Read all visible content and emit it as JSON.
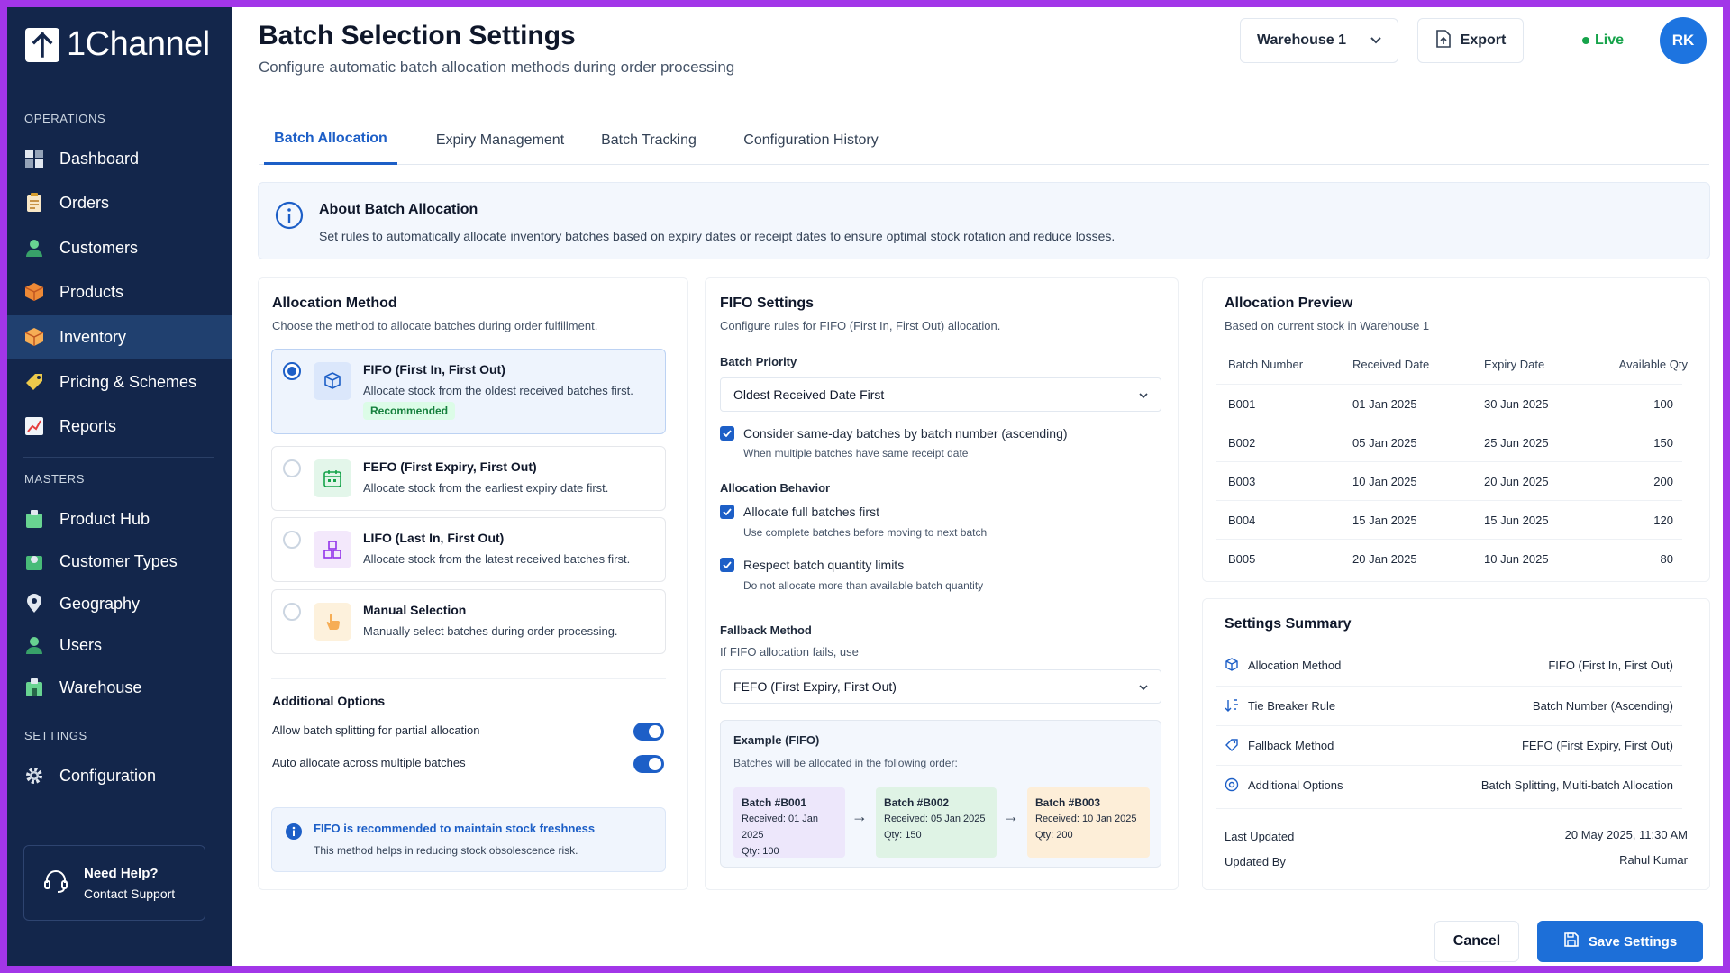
{
  "app": {
    "name": "1Channel"
  },
  "sidebar": {
    "sections": [
      "OPERATIONS",
      "MASTERS",
      "SETTINGS"
    ],
    "operations": [
      {
        "label": "Dashboard",
        "icon": "dashboard-icon"
      },
      {
        "label": "Orders",
        "icon": "clipboard-icon"
      },
      {
        "label": "Customers",
        "icon": "customers-icon"
      },
      {
        "label": "Products",
        "icon": "box-icon"
      },
      {
        "label": "Inventory",
        "icon": "inventory-icon",
        "active": true
      },
      {
        "label": "Pricing & Schemes",
        "icon": "tag-icon"
      },
      {
        "label": "Reports",
        "icon": "chart-icon"
      }
    ],
    "masters": [
      {
        "label": "Product Hub",
        "icon": "product-hub-icon"
      },
      {
        "label": "Customer Types",
        "icon": "customer-types-icon"
      },
      {
        "label": "Geography",
        "icon": "map-pin-icon"
      },
      {
        "label": "Users",
        "icon": "user-icon"
      },
      {
        "label": "Warehouse",
        "icon": "warehouse-icon"
      }
    ],
    "settings": [
      {
        "label": "Configuration",
        "icon": "gear-icon"
      }
    ],
    "help": {
      "title": "Need Help?",
      "link": "Contact Support"
    }
  },
  "header": {
    "title": "Batch Selection Settings",
    "subtitle": "Configure automatic batch allocation methods during order processing",
    "warehouse": "Warehouse 1",
    "export": "Export",
    "live": "Live",
    "avatar": "RK"
  },
  "tabs": [
    "Batch Allocation",
    "Expiry Management",
    "Batch Tracking",
    "Configuration History"
  ],
  "about": {
    "title": "About Batch Allocation",
    "text": "Set rules to automatically allocate inventory batches based on expiry dates or receipt dates to ensure optimal stock rotation and reduce losses."
  },
  "allocation": {
    "title": "Allocation Method",
    "subtitle": "Choose the method to allocate batches during order fulfillment.",
    "options": [
      {
        "title": "FIFO (First In, First Out)",
        "desc": "Allocate stock from the oldest received batches first.",
        "badge": "Recommended",
        "selected": true
      },
      {
        "title": "FEFO (First Expiry, First Out)",
        "desc": "Allocate stock from the earliest expiry date first."
      },
      {
        "title": "LIFO (Last In, First Out)",
        "desc": "Allocate stock from the latest received batches first."
      },
      {
        "title": "Manual Selection",
        "desc": "Manually select batches during order processing."
      }
    ],
    "additional_title": "Additional Options",
    "additional": [
      {
        "label": "Allow batch splitting for partial allocation",
        "on": true
      },
      {
        "label": "Auto allocate across multiple batches",
        "on": true
      }
    ],
    "info_title": "FIFO is recommended to maintain stock freshness",
    "info_text": "This method helps in reducing stock obsolescence risk."
  },
  "fifo": {
    "title": "FIFO Settings",
    "subtitle": "Configure rules for FIFO (First In, First Out) allocation.",
    "priority_label": "Batch Priority",
    "priority_value": "Oldest Received Date First",
    "same_day_label": "Consider same-day batches by batch number (ascending)",
    "same_day_desc": "When multiple batches have same receipt date",
    "behavior_title": "Allocation Behavior",
    "full_label": "Allocate full batches first",
    "full_desc": "Use complete batches before moving to next batch",
    "limits_label": "Respect batch quantity limits",
    "limits_desc": "Do not allocate more than available batch quantity",
    "fallback_title": "Fallback Method",
    "fallback_sub": "If FIFO allocation fails, use",
    "fallback_value": "FEFO (First Expiry, First Out)",
    "example_title": "Example (FIFO)",
    "example_sub": "Batches will be allocated in the following order:",
    "chips": [
      {
        "name": "Batch #B001",
        "received": "Received: 01 Jan 2025",
        "qty": "Qty: 100"
      },
      {
        "name": "Batch #B002",
        "received": "Received: 05 Jan 2025",
        "qty": "Qty: 150"
      },
      {
        "name": "Batch #B003",
        "received": "Received: 10 Jan 2025",
        "qty": "Qty: 200"
      }
    ]
  },
  "preview": {
    "title": "Allocation Preview",
    "subtitle": "Based on current stock in Warehouse 1",
    "headers": [
      "Batch Number",
      "Received Date",
      "Expiry Date",
      "Available Qty"
    ],
    "rows": [
      [
        "B001",
        "01 Jan 2025",
        "30 Jun 2025",
        "100"
      ],
      [
        "B002",
        "05 Jan 2025",
        "25 Jun 2025",
        "150"
      ],
      [
        "B003",
        "10 Jan 2025",
        "20 Jun 2025",
        "200"
      ],
      [
        "B004",
        "15 Jan 2025",
        "15 Jun 2025",
        "120"
      ],
      [
        "B005",
        "20 Jan 2025",
        "10 Jun 2025",
        "80"
      ]
    ]
  },
  "summary": {
    "title": "Settings Summary",
    "rows": [
      {
        "label": "Allocation Method",
        "value": "FIFO (First In, First Out)"
      },
      {
        "label": "Tie Breaker Rule",
        "value": "Batch Number (Ascending)"
      },
      {
        "label": "Fallback Method",
        "value": "FEFO (First Expiry, First Out)"
      },
      {
        "label": "Additional Options",
        "value": "Batch Splitting, Multi-batch Allocation"
      }
    ],
    "last_updated_label": "Last Updated",
    "last_updated": "20 May 2025, 11:30 AM",
    "updated_by_label": "Updated By",
    "updated_by": "Rahul Kumar"
  },
  "footer": {
    "cancel": "Cancel",
    "save": "Save Settings"
  }
}
